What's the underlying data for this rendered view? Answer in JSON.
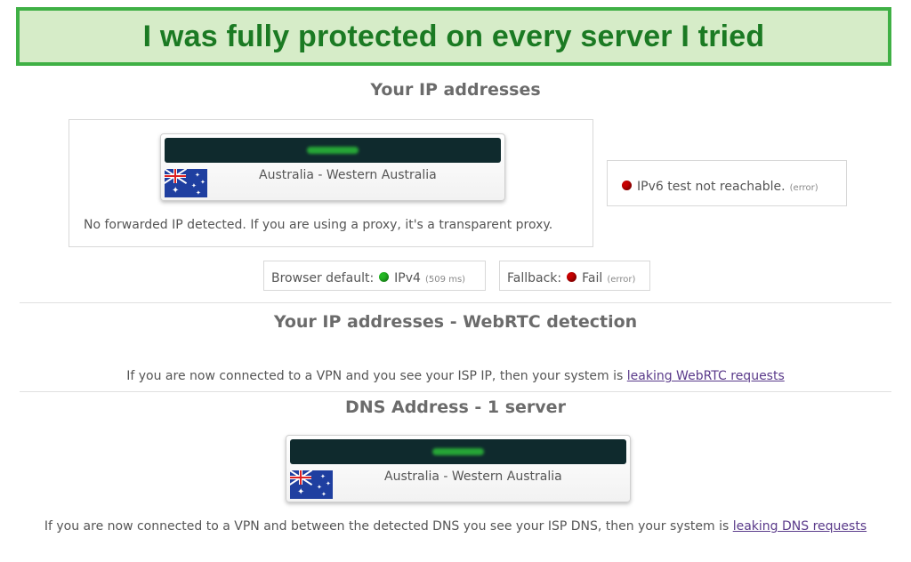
{
  "banner": {
    "text": "I was fully protected on every server I tried"
  },
  "ip_section": {
    "title": "Your IP addresses",
    "card": {
      "location": "Australia - Western Australia",
      "flag": "australia-flag"
    },
    "forwarded_note": "No forwarded IP detected. If you are using a proxy, it's a transparent proxy.",
    "ipv6": {
      "text": "IPv6 test not reachable.",
      "status": "(error)",
      "status_color": "#c80000"
    },
    "browser_default": {
      "label": "Browser default:",
      "value": "IPv4",
      "detail": "(509 ms)",
      "status_color": "#24b824"
    },
    "fallback": {
      "label": "Fallback:",
      "value": "Fail",
      "detail": "(error)",
      "status_color": "#c80000"
    }
  },
  "webrtc_section": {
    "title": "Your IP addresses - WebRTC detection",
    "note": "If you are now connected to a VPN and you see your ISP IP, then your system is",
    "link": "leaking WebRTC requests"
  },
  "dns_section": {
    "title": "DNS Address - 1 server",
    "card": {
      "location": "Australia - Western Australia",
      "flag": "australia-flag"
    },
    "note": "If you are now connected to a VPN and between the detected DNS you see your ISP DNS, then your system is",
    "link": "leaking DNS requests"
  }
}
